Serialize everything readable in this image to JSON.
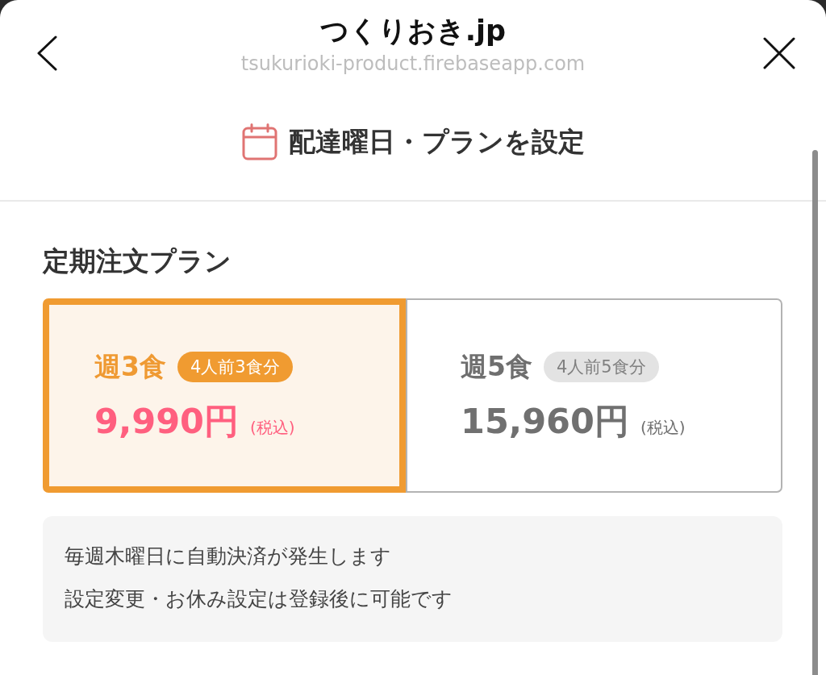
{
  "header": {
    "title": "つくりおき.jp",
    "url": "tsukurioki-product.firebaseapp.com"
  },
  "section": {
    "title": "配達曜日・プランを設定"
  },
  "plan_heading": "定期注文プラン",
  "plans": [
    {
      "name": "週3食",
      "badge": "4人前3食分",
      "price": "9,990円",
      "tax_note": "(税込)",
      "selected": true
    },
    {
      "name": "週5食",
      "badge": "4人前5食分",
      "price": "15,960円",
      "tax_note": "(税込)",
      "selected": false
    }
  ],
  "notice": {
    "lines": [
      "毎週木曜日に自動決済が発生します",
      "設定変更・お休み設定は登録後に可能です"
    ]
  }
}
